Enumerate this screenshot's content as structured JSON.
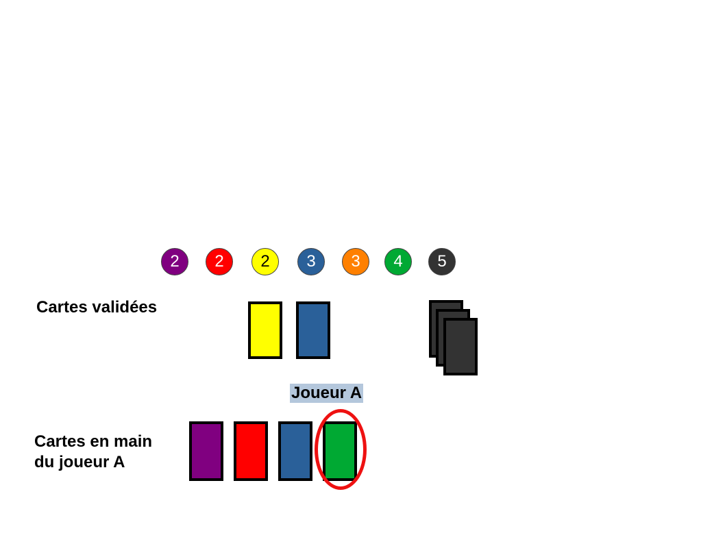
{
  "tokens": [
    {
      "number": "2",
      "color": "#800080",
      "text_color": "#ffffff"
    },
    {
      "number": "2",
      "color": "#ff0000",
      "text_color": "#ffffff"
    },
    {
      "number": "2",
      "color": "#ffff00",
      "text_color": "#000000"
    },
    {
      "number": "3",
      "color": "#2a6099",
      "text_color": "#ffffff"
    },
    {
      "number": "3",
      "color": "#ff8000",
      "text_color": "#ffffff"
    },
    {
      "number": "4",
      "color": "#00a933",
      "text_color": "#ffffff"
    },
    {
      "number": "5",
      "color": "#333333",
      "text_color": "#ffffff"
    }
  ],
  "validated": {
    "label": "Cartes validées",
    "cards": [
      {
        "color": "#ffff00"
      },
      {
        "color": "#2a6099"
      }
    ],
    "deck_color": "#333333",
    "deck_count": 3
  },
  "player": {
    "name": "Joueur A",
    "hand_label_line1": "Cartes en main",
    "hand_label_line2": "du joueur A",
    "hand": [
      {
        "color": "#800080"
      },
      {
        "color": "#ff0000"
      },
      {
        "color": "#2a6099"
      },
      {
        "color": "#00a933",
        "highlighted": true
      }
    ],
    "highlight_color": "#ee1111"
  }
}
